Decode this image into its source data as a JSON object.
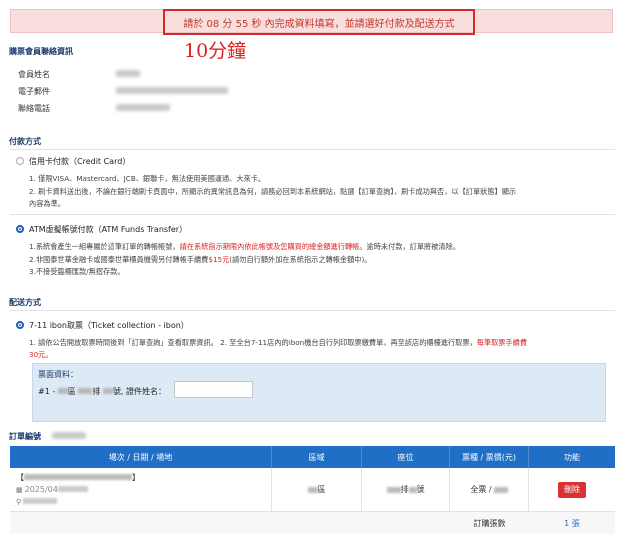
{
  "alert": {
    "countdown_text": "請於 08 分 55 秒 內完成資料填寫，並請選好付款及配送方式"
  },
  "annotation": {
    "text": "10分鐘"
  },
  "buyer": {
    "title": "購票會員聯絡資訊",
    "name_label": "會員姓名",
    "email_label": "電子郵件",
    "phone_label": "聯絡電話"
  },
  "payment": {
    "title": "付款方式",
    "options": [
      {
        "label": "信用卡付款（Credit Card）",
        "selected": false,
        "lines": [
          "1. 僅限VISA、Mastercard、JCB、銀聯卡，無法使用美國運通、大來卡。",
          "2. 刷卡資料送出後，不論在銀行端刷卡頁面中，所顯示的異常訊息為何，請務必回到本系統網站，點選【訂單查詢】，刷卡成功與否，以【訂單狀態】顯示",
          "內容為準。"
        ]
      },
      {
        "label": "ATM虛擬帳號付款（ATM Funds Transfer）",
        "selected": true,
        "line1_pre": "1.系統會產生一組專屬於這筆訂單的轉帳帳號，",
        "line1_red": "請在系統指示期限內依此帳號及您購買的總金額進行轉帳",
        "line1_post": "。逾時未付款，訂單將被清除。",
        "line2_pre": "2.非國泰世華金融卡或國泰世華櫃員機需另付轉帳手續費",
        "line2_red": "$15元",
        "line2_post": "(請勿自行額外加在系統指示之轉帳金額中)。",
        "line3": "3.不接受臨櫃匯款/無摺存款。"
      }
    ]
  },
  "delivery": {
    "title": "配送方式",
    "option_label": "7-11 ibon取票（Ticket collection - ibon）",
    "line1_pre": "1. 請依公告開放取票時間後到「訂單查詢」查看取票資訊。 2. 至全台7-11店內的ibon機台自行列印取票繳費單，再至該店的櫃檯進行取票，",
    "line1_red": "每筆取票手續費",
    "line2_red": "30元。",
    "ticket_info_title": "票面資料：",
    "ticket_line_prefix": "#1 -",
    "area_suffix": "區",
    "row_suffix": "排",
    "seat_suffix": "號, 證件姓名："
  },
  "order": {
    "title": "訂單編號",
    "columns": [
      "場次 / 日期 / 場地",
      "區域",
      "座位",
      "票種 / 票價(元)",
      "功能"
    ],
    "row": {
      "bracket_open": "【",
      "bracket_close": "】",
      "date_prefix": "2025/04",
      "area_suffix": "區",
      "seat_suffix": "排",
      "seat_num": "號",
      "ticket_type": "全票 /",
      "delete_label": "刪除"
    },
    "count_label": "訂購張數",
    "count_value": "1 張"
  }
}
